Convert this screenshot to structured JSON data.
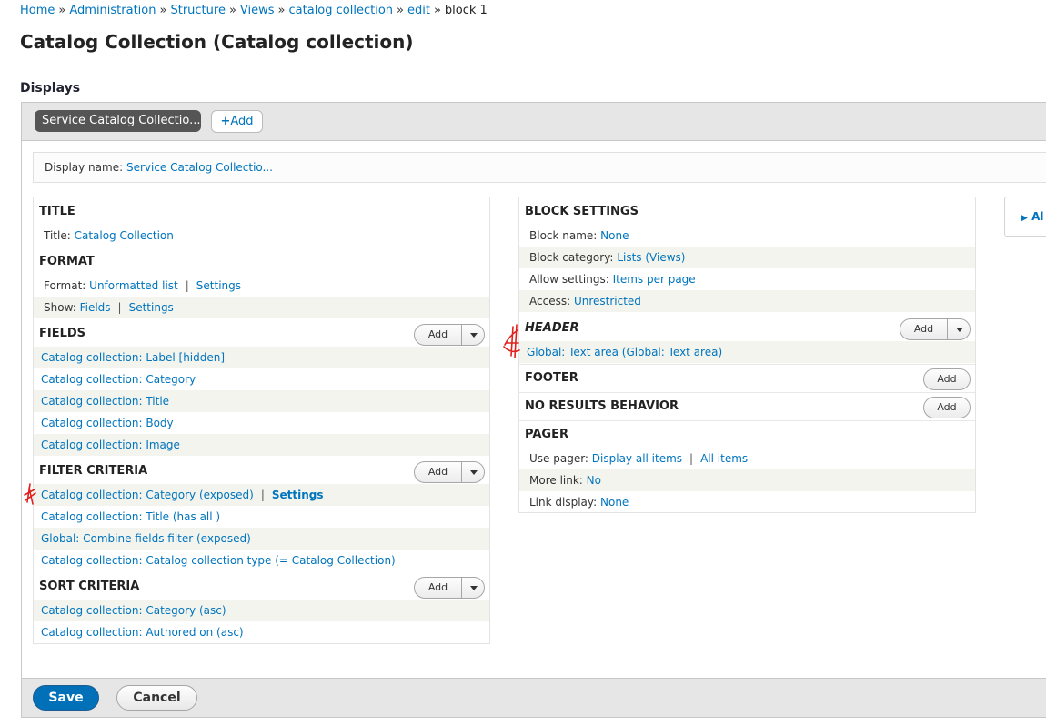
{
  "breadcrumb": [
    "Home",
    "Administration",
    "Structure",
    "Views",
    "catalog collection",
    "edit",
    "block 1"
  ],
  "breadcrumb_sep": "»",
  "page_title": "Catalog Collection (Catalog collection)",
  "displays_heading": "Displays",
  "display_tab": "Service Catalog Collectio...",
  "add_display": "Add",
  "display_name": {
    "label": "Display name:",
    "value": "Service Catalog Collectio..."
  },
  "left": {
    "title": {
      "heading": "TITLE",
      "label": "Title:",
      "value": "Catalog Collection"
    },
    "format": {
      "heading": "FORMAT",
      "format_label": "Format:",
      "format_value": "Unformatted list",
      "format_settings": "Settings",
      "show_label": "Show:",
      "show_value": "Fields",
      "show_settings": "Settings"
    },
    "fields": {
      "heading": "FIELDS",
      "add": "Add",
      "items": [
        "Catalog collection: Label [hidden]",
        "Catalog collection: Category",
        "Catalog collection: Title",
        "Catalog collection: Body",
        "Catalog collection: Image"
      ]
    },
    "filters": {
      "heading": "FILTER CRITERIA",
      "add": "Add",
      "items": [
        "Catalog collection: Category (exposed)",
        "Catalog collection: Title (has all )",
        "Global: Combine fields filter (exposed)",
        "Catalog collection: Catalog collection type (= Catalog Collection)"
      ],
      "first_settings": "Settings"
    },
    "sorts": {
      "heading": "SORT CRITERIA",
      "add": "Add",
      "items": [
        "Catalog collection: Category (asc)",
        "Catalog collection: Authored on (asc)"
      ]
    }
  },
  "right": {
    "block": {
      "heading": "BLOCK SETTINGS",
      "rows": [
        {
          "label": "Block name:",
          "value": "None"
        },
        {
          "label": "Block category:",
          "value": "Lists (Views)"
        },
        {
          "label": "Allow settings:",
          "value": "Items per page"
        },
        {
          "label": "Access:",
          "value": "Unrestricted"
        }
      ]
    },
    "header": {
      "heading": "HEADER",
      "add": "Add",
      "items": [
        "Global: Text area (Global: Text area)"
      ]
    },
    "footer": {
      "heading": "FOOTER",
      "add": "Add"
    },
    "no_results": {
      "heading": "NO RESULTS BEHAVIOR",
      "add": "Add"
    },
    "pager": {
      "heading": "PAGER",
      "use_pager_label": "Use pager:",
      "use_pager_value": "Display all items",
      "use_pager_extra": "All items",
      "more_link_label": "More link:",
      "more_link_value": "No",
      "link_display_label": "Link display:",
      "link_display_value": "None"
    }
  },
  "advanced": "Al",
  "save": "Save",
  "cancel": "Cancel",
  "colors": {
    "link": "#0074bd",
    "save": "#0071b8",
    "annotation": "#e0201b"
  }
}
